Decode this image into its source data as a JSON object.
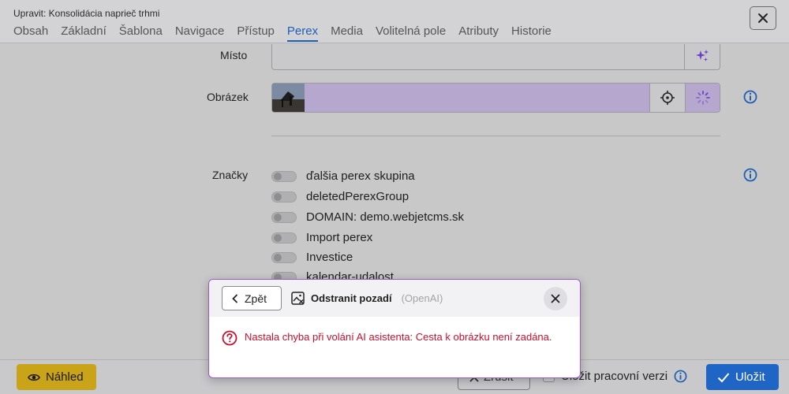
{
  "header": {
    "title": "Upravit: Konsolidácia naprieč trhmi",
    "tabs": [
      "Obsah",
      "Základní",
      "Šablona",
      "Navigace",
      "Přístup",
      "Perex",
      "Media",
      "Volitelná pole",
      "Atributy",
      "Historie"
    ],
    "active_tab": "Perex"
  },
  "form": {
    "place_label": "Místo",
    "place_value": "",
    "image_label": "Obrázek",
    "tags_label": "Značky",
    "tags": [
      "ďalšia perex skupina",
      "deletedPerexGroup",
      "DOMAIN: demo.webjetcms.sk",
      "Import perex",
      "Investice",
      "kalendar-udalost"
    ]
  },
  "footer": {
    "preview_label": "Náhled",
    "cancel_label": "Zrušit",
    "save_draft_label": "Uložit pracovní verzi",
    "save_label": "Uložit"
  },
  "dialog": {
    "back_label": "Zpět",
    "title": "Odstranit pozadí",
    "subtitle": "(OpenAI)",
    "error_message": "Nastala chyba při volání AI asistenta: Cesta k obrázku není zadána."
  },
  "colors": {
    "accent": "#1e5fb3",
    "image_field": "#b5a7cd",
    "preview_button": "#c9a318",
    "save_button": "#1f65c6",
    "dialog_border": "#9b59d6",
    "error": "#c8102e"
  },
  "icons": {
    "place_ai": "sparkles-icon",
    "image_focus": "crosshair-icon",
    "image_loading": "spinner-icon",
    "info": "info-icon",
    "preview": "eye-icon",
    "save": "check-icon",
    "dialog_image": "image-remove-icon",
    "error": "question-circle-icon"
  }
}
